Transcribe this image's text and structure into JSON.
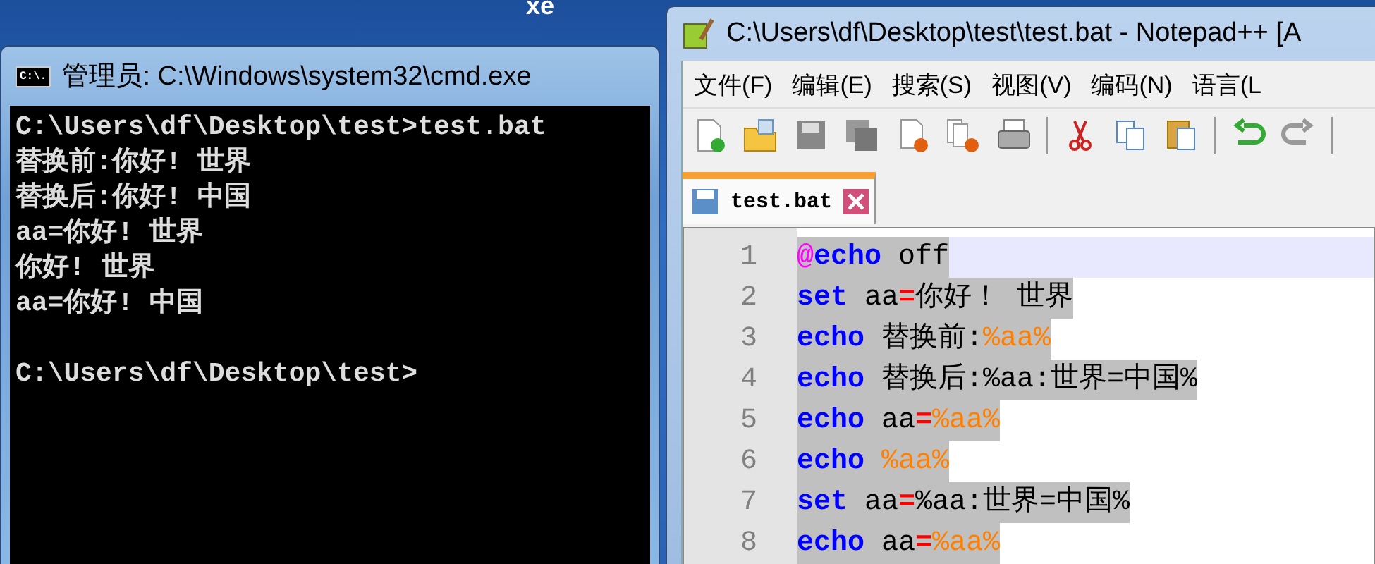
{
  "background_window": {
    "title_fragment": "xe"
  },
  "console": {
    "title": "管理员: C:\\Windows\\system32\\cmd.exe",
    "icon_text": "C:\\.",
    "lines": [
      "C:\\Users\\df\\Desktop\\test>test.bat",
      "替换前:你好! 世界",
      "替换后:你好! 中国",
      "aa=你好! 世界",
      "你好! 世界",
      "aa=你好! 中国"
    ],
    "prompt": "C:\\Users\\df\\Desktop\\test>"
  },
  "editor": {
    "title": "C:\\Users\\df\\Desktop\\test\\test.bat - Notepad++ [A",
    "menu": [
      "文件(F)",
      "编辑(E)",
      "搜索(S)",
      "视图(V)",
      "编码(N)",
      "语言(L"
    ],
    "tabs": [
      {
        "label": "test.bat",
        "selected": true
      }
    ],
    "lines": [
      {
        "number": "1",
        "current": true,
        "tokens": [
          {
            "kind": "at",
            "text": "@"
          },
          {
            "kind": "keyword",
            "text": "echo"
          },
          {
            "kind": "plain",
            "text": " off"
          }
        ]
      },
      {
        "number": "2",
        "current": false,
        "tokens": [
          {
            "kind": "keyword",
            "text": "set"
          },
          {
            "kind": "plain",
            "text": " aa"
          },
          {
            "kind": "operator",
            "text": "="
          },
          {
            "kind": "plain",
            "text": "你好！ 世界"
          }
        ]
      },
      {
        "number": "3",
        "current": false,
        "tokens": [
          {
            "kind": "keyword",
            "text": "echo"
          },
          {
            "kind": "plain",
            "text": " 替换前:"
          },
          {
            "kind": "variable",
            "text": "%aa%"
          }
        ]
      },
      {
        "number": "4",
        "current": false,
        "tokens": [
          {
            "kind": "keyword",
            "text": "echo"
          },
          {
            "kind": "plain",
            "text": " 替换后:%aa:世界=中国%"
          }
        ]
      },
      {
        "number": "5",
        "current": false,
        "tokens": [
          {
            "kind": "keyword",
            "text": "echo"
          },
          {
            "kind": "plain",
            "text": " aa"
          },
          {
            "kind": "operator",
            "text": "="
          },
          {
            "kind": "variable",
            "text": "%aa%"
          }
        ]
      },
      {
        "number": "6",
        "current": false,
        "tokens": [
          {
            "kind": "keyword",
            "text": "echo"
          },
          {
            "kind": "variable",
            "text": " %aa%"
          }
        ]
      },
      {
        "number": "7",
        "current": false,
        "tokens": [
          {
            "kind": "keyword",
            "text": "set"
          },
          {
            "kind": "plain",
            "text": " aa"
          },
          {
            "kind": "operator",
            "text": "="
          },
          {
            "kind": "plain",
            "text": "%aa:世界=中国%"
          }
        ]
      },
      {
        "number": "8",
        "current": false,
        "tokens": [
          {
            "kind": "keyword",
            "text": "echo"
          },
          {
            "kind": "plain",
            "text": " aa"
          },
          {
            "kind": "operator",
            "text": "="
          },
          {
            "kind": "variable",
            "text": "%aa%"
          }
        ]
      }
    ]
  }
}
